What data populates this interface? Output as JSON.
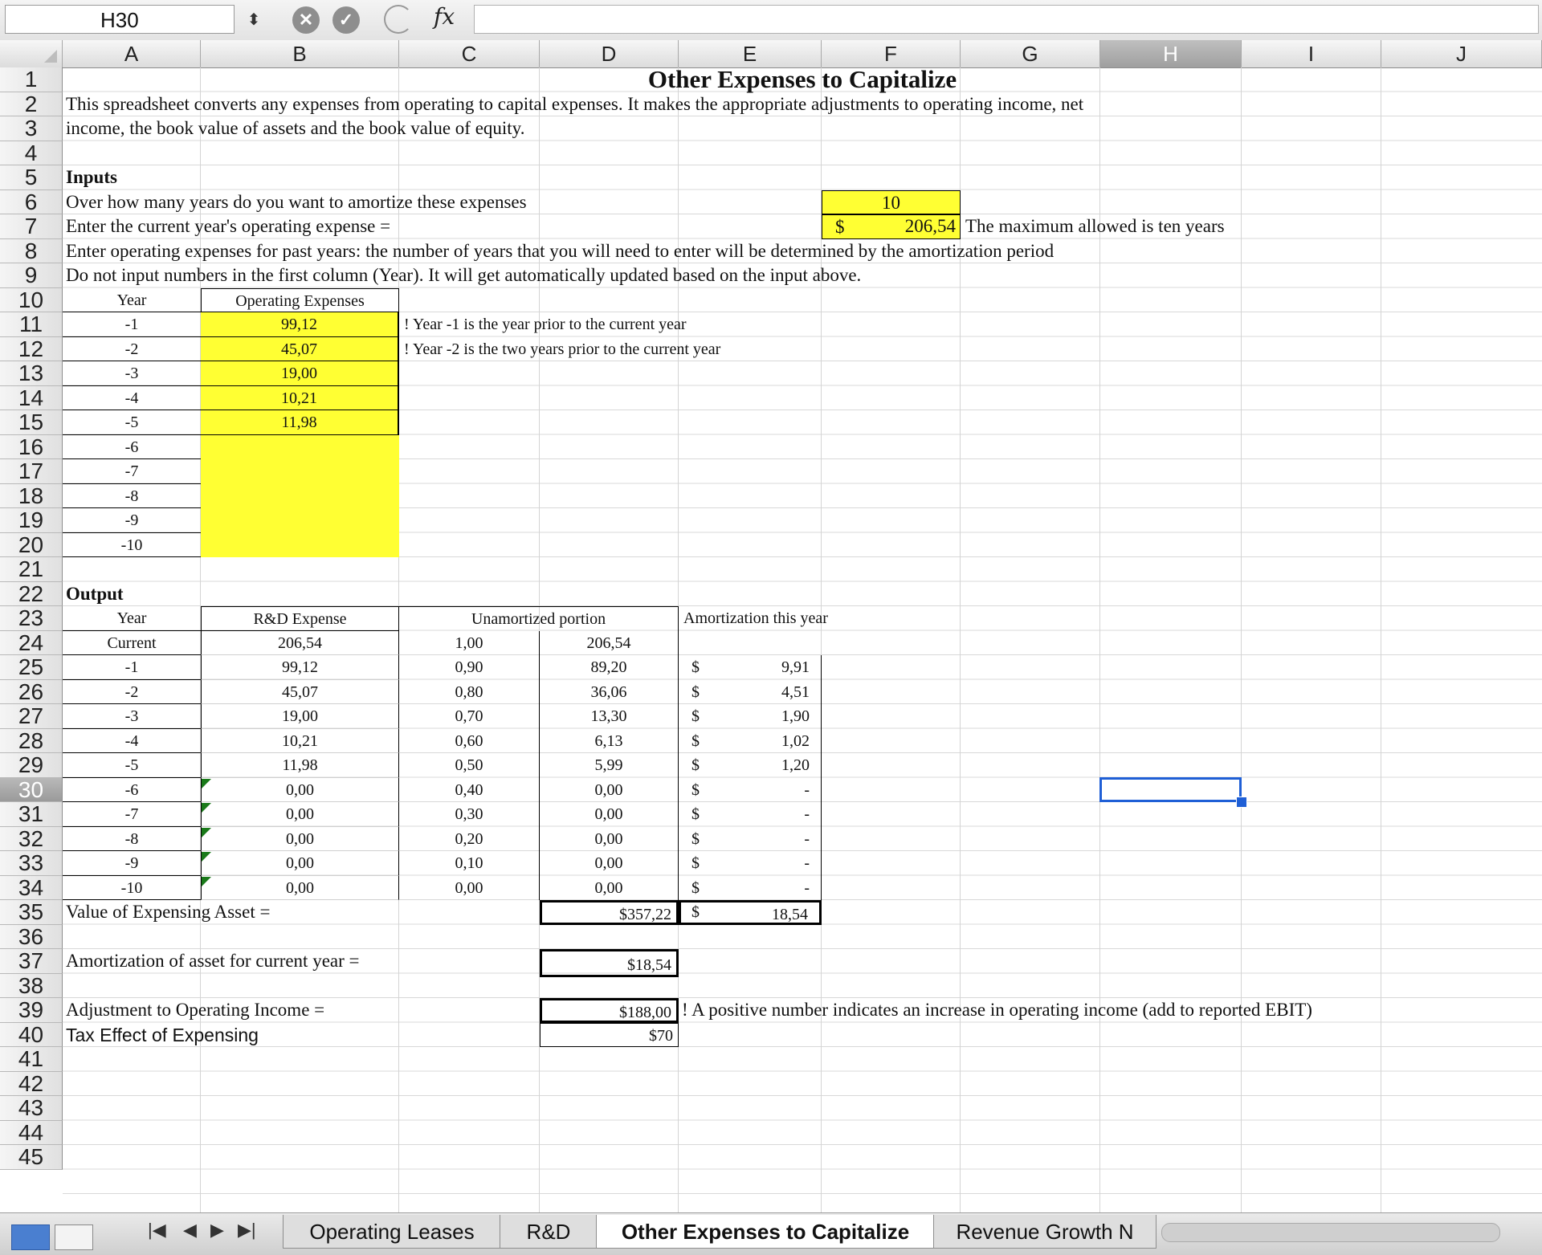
{
  "formula_bar": {
    "name_box": "H30",
    "fx_label": "fx",
    "formula": ""
  },
  "columns": [
    "A",
    "B",
    "C",
    "D",
    "E",
    "F",
    "G",
    "H",
    "I",
    "J"
  ],
  "rows": [
    "1",
    "2",
    "3",
    "4",
    "5",
    "6",
    "7",
    "8",
    "9",
    "10",
    "11",
    "12",
    "13",
    "14",
    "15",
    "16",
    "17",
    "18",
    "19",
    "20",
    "21",
    "22",
    "23",
    "24",
    "25",
    "26",
    "27",
    "28",
    "29",
    "30",
    "31",
    "32",
    "33",
    "34",
    "35",
    "36",
    "37",
    "38",
    "39",
    "40",
    "41",
    "42",
    "43",
    "44",
    "45"
  ],
  "active_cell": {
    "column": "H",
    "row": "30"
  },
  "sheet": {
    "title": "Other Expenses to Capitalize",
    "intro_line1": "This spreadsheet converts any expenses from operating to capital expenses. It makes the appropriate adjustments to operating income, net",
    "intro_line2": "income, the book value of assets and the book value of equity.",
    "inputs_heading": "Inputs",
    "amort_years_label": "Over how many years do you want to amortize these expenses",
    "amort_years_value": "10",
    "current_expense_label": "Enter the current year's operating expense =",
    "current_expense_currency": "$",
    "current_expense_value": "206,54",
    "max_allowed_note": "The maximum allowed is ten years",
    "past_years_instruction": "Enter operating expenses for past years: the number of years that you will need to enter will be determined by the amortization period",
    "no_input_instruction": "Do not input numbers in the first column (Year). It will get automatically updated  based on the input above.",
    "input_table": {
      "year_header": "Year",
      "expense_header": "Operating Expenses",
      "rows": [
        {
          "year": "-1",
          "expense": "99,12"
        },
        {
          "year": "-2",
          "expense": "45,07"
        },
        {
          "year": "-3",
          "expense": "19,00"
        },
        {
          "year": "-4",
          "expense": "10,21"
        },
        {
          "year": "-5",
          "expense": "11,98"
        },
        {
          "year": "-6",
          "expense": ""
        },
        {
          "year": "-7",
          "expense": ""
        },
        {
          "year": "-8",
          "expense": ""
        },
        {
          "year": "-9",
          "expense": ""
        },
        {
          "year": "-10",
          "expense": ""
        }
      ],
      "note1": "! Year -1 is the year prior to the current year",
      "note2": "! Year -2 is the two years prior to the current year"
    },
    "output_heading": "Output",
    "output_table": {
      "year_header": "Year",
      "expense_header": "R&D Expense",
      "unamortized_header": "Unamortized portion",
      "amortization_header": "Amortization this year",
      "rows": [
        {
          "year": "Current",
          "expense": "206,54",
          "factor": "1,00",
          "unamortized": "206,54",
          "currency": "",
          "amortization": ""
        },
        {
          "year": "-1",
          "expense": "99,12",
          "factor": "0,90",
          "unamortized": "89,20",
          "currency": "$",
          "amortization": "9,91"
        },
        {
          "year": "-2",
          "expense": "45,07",
          "factor": "0,80",
          "unamortized": "36,06",
          "currency": "$",
          "amortization": "4,51"
        },
        {
          "year": "-3",
          "expense": "19,00",
          "factor": "0,70",
          "unamortized": "13,30",
          "currency": "$",
          "amortization": "1,90"
        },
        {
          "year": "-4",
          "expense": "10,21",
          "factor": "0,60",
          "unamortized": "6,13",
          "currency": "$",
          "amortization": "1,02"
        },
        {
          "year": "-5",
          "expense": "11,98",
          "factor": "0,50",
          "unamortized": "5,99",
          "currency": "$",
          "amortization": "1,20"
        },
        {
          "year": "-6",
          "expense": "0,00",
          "factor": "0,40",
          "unamortized": "0,00",
          "currency": "$",
          "amortization": "-"
        },
        {
          "year": "-7",
          "expense": "0,00",
          "factor": "0,30",
          "unamortized": "0,00",
          "currency": "$",
          "amortization": "-"
        },
        {
          "year": "-8",
          "expense": "0,00",
          "factor": "0,20",
          "unamortized": "0,00",
          "currency": "$",
          "amortization": "-"
        },
        {
          "year": "-9",
          "expense": "0,00",
          "factor": "0,10",
          "unamortized": "0,00",
          "currency": "$",
          "amortization": "-"
        },
        {
          "year": "-10",
          "expense": "0,00",
          "factor": "0,00",
          "unamortized": "0,00",
          "currency": "$",
          "amortization": "-"
        }
      ]
    },
    "value_asset_label": "Value of Expensing Asset =",
    "value_asset_total": "$357,22",
    "value_asset_currency": "$",
    "value_asset_amortization": "18,54",
    "amort_current_label": "Amortization of asset for current year =",
    "amort_current_value": "$18,54",
    "adj_operating_label": "Adjustment to Operating Income =",
    "adj_operating_value": "$188,00",
    "adj_operating_note": "! A positive number indicates an increase in operating income (add to reported EBIT)",
    "tax_effect_label": "Tax Effect of  Expensing",
    "tax_effect_value": "$70"
  },
  "tabs": {
    "items": [
      {
        "label": "Operating Leases",
        "active": false
      },
      {
        "label": "R&D",
        "active": false
      },
      {
        "label": "Other Expenses to Capitalize",
        "active": true
      },
      {
        "label": "Revenue Growth N",
        "active": false
      }
    ]
  },
  "colors": {
    "input_fill": "#ffff33",
    "selection": "#1f5fd6"
  }
}
